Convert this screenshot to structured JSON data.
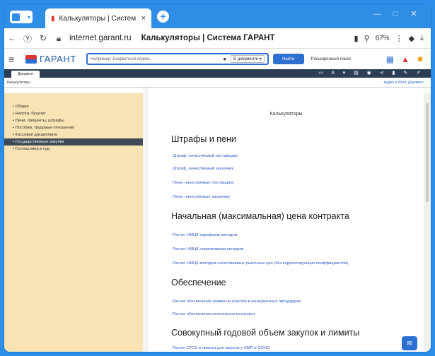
{
  "browser": {
    "tab_title": "Калькуляторы | Систем",
    "tab_close": "×",
    "new_tab": "+",
    "url_host": "internet.garant.ru",
    "page_title": "Калькуляторы | Система ГАРАНТ",
    "zoom": "67%",
    "controls": [
      "—",
      "□",
      "✕"
    ]
  },
  "garant_toolbar": {
    "logo_text": "ГАРАНТ",
    "search_placeholder": "Например: Бюджетный кодекс",
    "search_scope": "В документе ▾",
    "find_button": "Найти",
    "advanced_search": "Расширенный поиск"
  },
  "document_bar": {
    "tab_label": "Документ",
    "breadcrumb": "Калькуляторы",
    "right_link": "Аудио в Word; Документ"
  },
  "sidebar": {
    "items": [
      {
        "label": "• Общие"
      },
      {
        "label": "• Налоги, бухучет"
      },
      {
        "label": "• Пени, проценты, штрафы"
      },
      {
        "label": "• Пособия, трудовые отношения"
      },
      {
        "label": "• Кассовая дисциплина"
      },
      {
        "label": "• Государственные закупки"
      },
      {
        "label": "• Госпошлина в суд"
      }
    ],
    "active_index": 5
  },
  "content": {
    "page_heading": "Калькуляторы",
    "sections": [
      {
        "title": "Штрафы и пени",
        "links": [
          "Штраф, начисляемый поставщику",
          "Штраф, начисляемый заказчику",
          "Пени, начисляемые поставщику",
          "Пени, начисляемые заказчику"
        ]
      },
      {
        "title": "Начальная (максимальная) цена контракта",
        "links": [
          "Расчет НМЦК тарифным методом",
          "Расчет НМЦК нормативным методом",
          "Расчет НМЦК методом сопоставимых рыночных цен (без корректирующих коэффициентов)"
        ]
      },
      {
        "title": "Обеспечение",
        "links": [
          "Расчет обеспечения заявки на участие в конкурентных процедурах",
          "Расчет обеспечения исполнения контракта"
        ]
      },
      {
        "title": "Совокупный годовой объем закупок и лимиты",
        "links": [
          "Расчет СГОЗ и лимита для закупок у СМП и СОНО"
        ]
      }
    ]
  },
  "colors": {
    "accent": "#2f8de6",
    "sidebar_bg": "#f7e3b4",
    "sidebar_active": "#3f4a56",
    "link": "#2b59c3"
  }
}
